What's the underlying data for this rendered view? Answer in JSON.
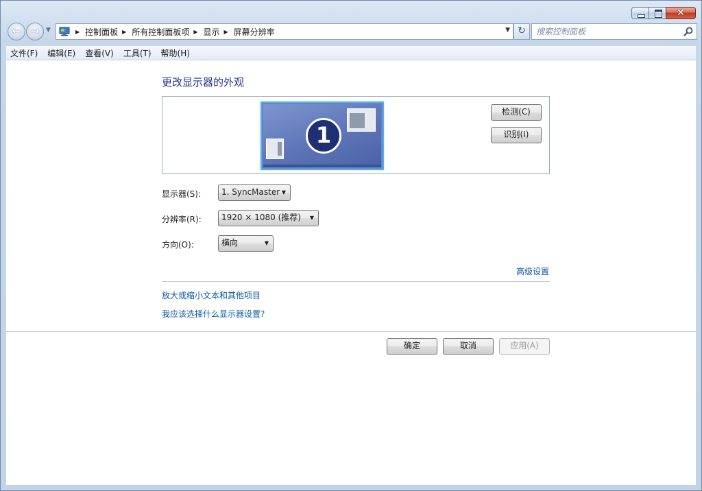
{
  "window": {
    "close_glyph": "✕"
  },
  "nav": {
    "back_glyph": "←",
    "forward_glyph": "→",
    "breadcrumbs": [
      "控制面板",
      "所有控制面板项",
      "显示",
      "屏幕分辨率"
    ],
    "refresh_glyph": "↻",
    "search_placeholder": "搜索控制面板"
  },
  "menu": {
    "items": [
      "文件(F)",
      "编辑(E)",
      "查看(V)",
      "工具(T)",
      "帮助(H)"
    ]
  },
  "main": {
    "title": "更改显示器的外观",
    "monitor_number": "1",
    "detect_label": "检测(C)",
    "identify_label": "识别(I)",
    "display_label": "显示器(S):",
    "display_value": "1. SyncMaster",
    "resolution_label": "分辨率(R):",
    "resolution_value": "1920 × 1080 (推荐)",
    "orientation_label": "方向(O):",
    "orientation_value": "横向",
    "advanced_link": "高级设置",
    "zoom_link": "放大或缩小文本和其他项目",
    "help_link": "我应该选择什么显示器设置?"
  },
  "footer": {
    "ok_label": "确定",
    "cancel_label": "取消",
    "apply_label": "应用(A)"
  },
  "icons": {
    "dropdown": "▼",
    "breadcrumb_separator": "▶"
  }
}
